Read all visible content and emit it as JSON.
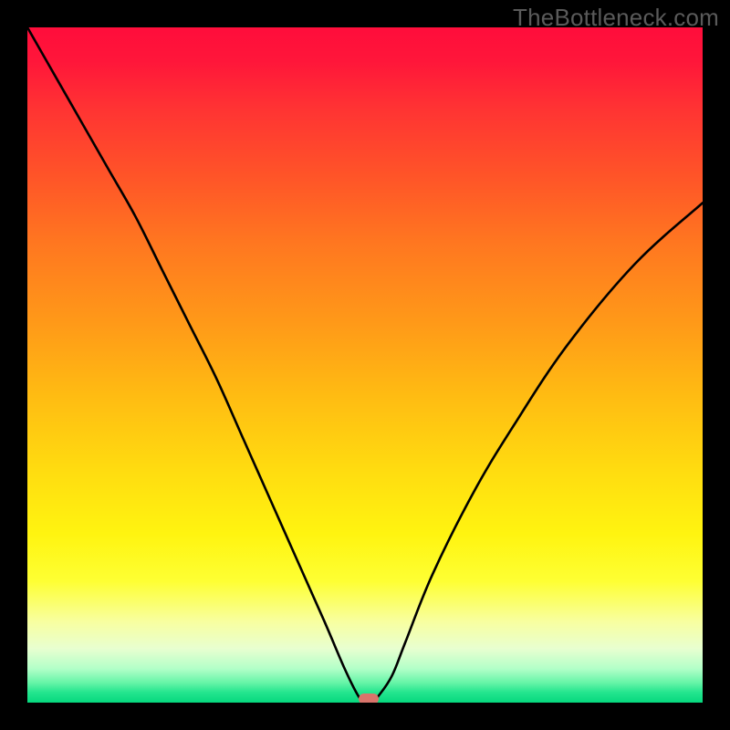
{
  "watermark": "TheBottleneck.com",
  "chart_data": {
    "type": "line",
    "title": "",
    "xlabel": "",
    "ylabel": "",
    "xlim": [
      0,
      100
    ],
    "ylim": [
      0,
      100
    ],
    "background": {
      "style": "vertical-gradient",
      "meaning": "red=high bottleneck, green=low bottleneck",
      "stops": [
        {
          "pos": 0.0,
          "color": "#ff0d3b"
        },
        {
          "pos": 0.22,
          "color": "#ff5428"
        },
        {
          "pos": 0.55,
          "color": "#ffbd12"
        },
        {
          "pos": 0.82,
          "color": "#feff33"
        },
        {
          "pos": 0.97,
          "color": "#68f5a8"
        },
        {
          "pos": 1.0,
          "color": "#06d87e"
        }
      ]
    },
    "series": [
      {
        "name": "bottleneck-curve",
        "x": [
          0,
          4,
          8,
          12,
          16,
          20,
          24,
          28,
          32,
          36,
          40,
          44,
          47,
          49,
          50,
          51,
          52,
          54,
          56,
          60,
          66,
          72,
          80,
          90,
          100
        ],
        "y": [
          100,
          93,
          86,
          79,
          72,
          64,
          56,
          48,
          39,
          30,
          21,
          12,
          5,
          1,
          0,
          0,
          1,
          4,
          9,
          19,
          31,
          41,
          53,
          65,
          74
        ]
      }
    ],
    "marker": {
      "x": 50.5,
      "y": 0.5,
      "shape": "capsule",
      "color": "#d9746b"
    },
    "colors": {
      "curve": "#000000",
      "frame": "#000000"
    }
  }
}
